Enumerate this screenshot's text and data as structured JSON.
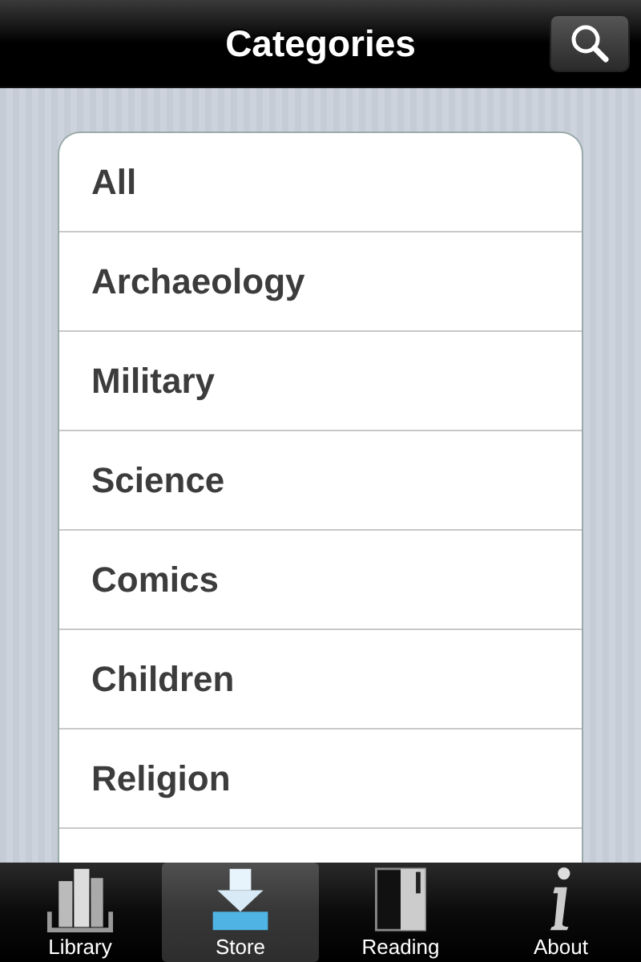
{
  "nav_bar": {
    "title": "Categories"
  },
  "categories": [
    "All",
    "Archaeology",
    "Military",
    "Science",
    "Comics",
    "Children",
    "Religion"
  ],
  "tab_bar": [
    {
      "label": "Library",
      "selected": false
    },
    {
      "label": "Store",
      "selected": true
    },
    {
      "label": "Reading",
      "selected": false
    },
    {
      "label": "About",
      "selected": false
    }
  ]
}
